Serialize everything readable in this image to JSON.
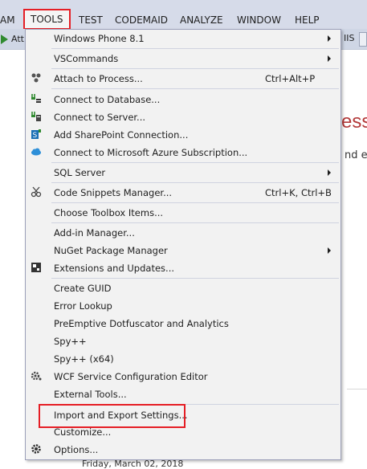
{
  "menubar": {
    "items": [
      "AM",
      "TOOLS",
      "TEST",
      "CODEMAID",
      "ANALYZE",
      "WINDOW",
      "HELP"
    ]
  },
  "toolbar": {
    "attach_label": "Att",
    "iis_label": "IIS"
  },
  "background": {
    "title_fragment": "ess",
    "text_fragment": "nd er",
    "date_fragment": "Friday, March 02, 2018"
  },
  "menu": {
    "items": [
      {
        "label": "Windows Phone 8.1",
        "submenu": true
      },
      {
        "label": "VSCommands",
        "submenu": true
      },
      {
        "label": "Attach to Process...",
        "shortcut": "Ctrl+Alt+P",
        "icon": "attach-process-icon"
      },
      {
        "label": "Connect to Database...",
        "icon": "database-plug-icon"
      },
      {
        "label": "Connect to Server...",
        "icon": "server-plug-icon"
      },
      {
        "label": "Add SharePoint Connection...",
        "icon": "sharepoint-icon"
      },
      {
        "label": "Connect to Microsoft Azure Subscription...",
        "icon": "azure-cloud-icon"
      },
      {
        "label": "SQL Server",
        "submenu": true
      },
      {
        "label": "Code Snippets Manager...",
        "shortcut": "Ctrl+K, Ctrl+B",
        "icon": "snippets-icon"
      },
      {
        "label": "Choose Toolbox Items..."
      },
      {
        "label": "Add-in Manager..."
      },
      {
        "label": "NuGet Package Manager",
        "submenu": true
      },
      {
        "label": "Extensions and Updates...",
        "icon": "extensions-icon"
      },
      {
        "label": "Create GUID"
      },
      {
        "label": "Error Lookup"
      },
      {
        "label": "PreEmptive Dotfuscator and Analytics"
      },
      {
        "label": "Spy++"
      },
      {
        "label": "Spy++ (x64)"
      },
      {
        "label": "WCF Service Configuration Editor",
        "icon": "wcf-gear-icon"
      },
      {
        "label": "External Tools..."
      },
      {
        "label": "Import and Export Settings..."
      },
      {
        "label": "Customize..."
      },
      {
        "label": "Options...",
        "icon": "options-gear-icon"
      }
    ]
  },
  "colors": {
    "highlight": "#e51e25",
    "menu_bg": "#f2f2f2",
    "menubar_bg": "#d6dbe9"
  }
}
